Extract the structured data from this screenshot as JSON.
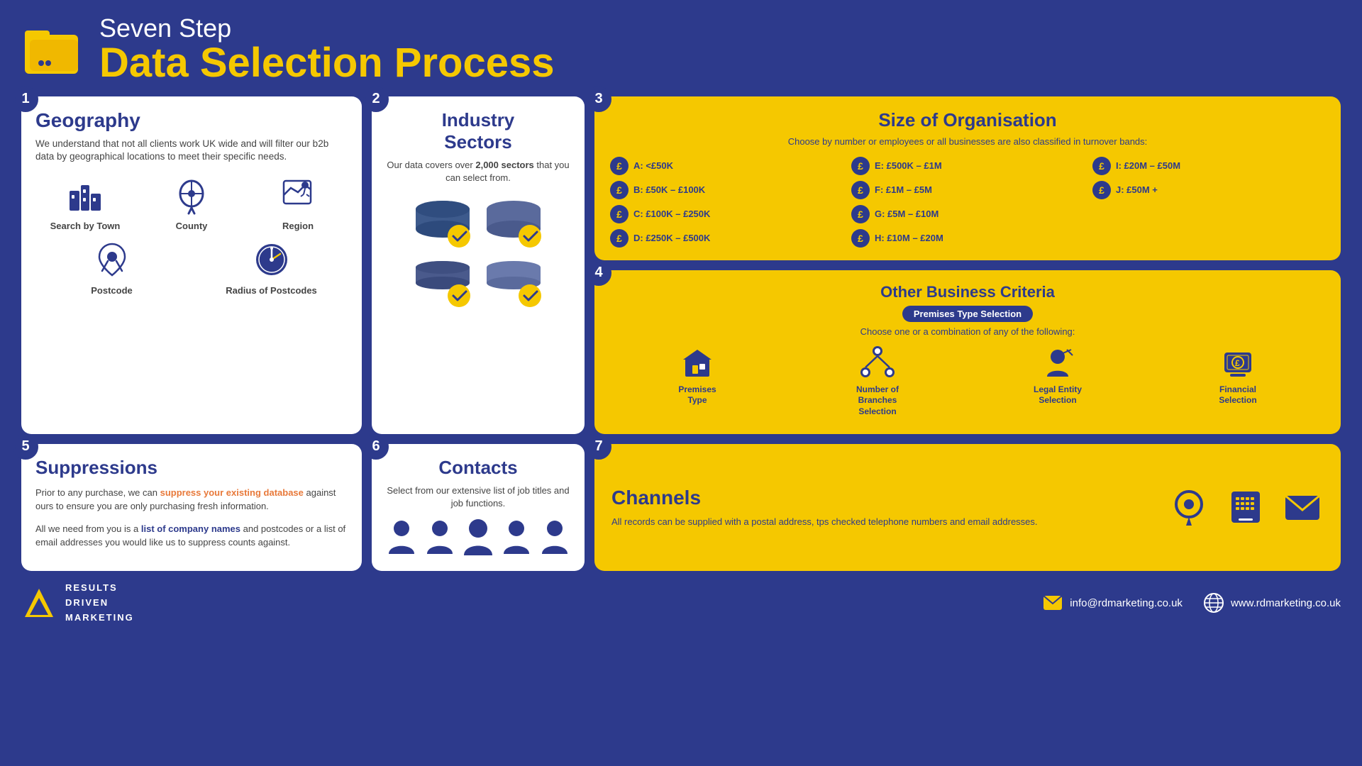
{
  "header": {
    "subtitle": "Seven Step",
    "title": "Data Selection Process"
  },
  "step1": {
    "badge": "1",
    "title": "Geography",
    "desc": "We understand that not all clients work UK wide and will filter our b2b data by geographical locations to meet their specific needs.",
    "items": [
      {
        "label": "Search by Town"
      },
      {
        "label": "County"
      },
      {
        "label": "Region"
      },
      {
        "label": "Postcode"
      },
      {
        "label": "Radius of Postcodes"
      }
    ]
  },
  "step2": {
    "badge": "2",
    "title": "Industry\nSectors",
    "desc_plain": "Our data covers over ",
    "desc_bold": "2,000 sectors",
    "desc_end": " that you can select from."
  },
  "step3": {
    "badge": "3",
    "title": "Size of Organisation",
    "desc": "Choose by number or employees or all businesses are also classified in turnover bands:",
    "items": [
      {
        "label": "A: <£50K"
      },
      {
        "label": "E: £500K – £1M"
      },
      {
        "label": "I: £20M – £50M"
      },
      {
        "label": "B: £50K – £100K"
      },
      {
        "label": "F: £1M – £5M"
      },
      {
        "label": "J: £50M +"
      },
      {
        "label": "C: £100K – £250K"
      },
      {
        "label": "G: £5M – £10M"
      },
      {
        "label": ""
      },
      {
        "label": "D: £250K – £500K"
      },
      {
        "label": "H: £10M – £20M"
      },
      {
        "label": ""
      }
    ]
  },
  "step4": {
    "badge": "4",
    "title": "Other Business Criteria",
    "badge_label": "Premises Type Selection",
    "desc": "Choose one or a combination of any of the following:",
    "items": [
      {
        "label": "Premises\nType"
      },
      {
        "label": "Number of\nBranches\nSelection"
      },
      {
        "label": "Legal Entity\nSelection"
      },
      {
        "label": "Financial\nSelection"
      }
    ]
  },
  "step5": {
    "badge": "5",
    "title": "Suppressions",
    "desc1": "Prior to any purchase, we can ",
    "desc1_highlight": "suppress your existing database",
    "desc1_end": " against ours to ensure you are only purchasing fresh information.",
    "desc2_start": "All we need from you is a ",
    "desc2_highlight": "list of company names",
    "desc2_end": " and postcodes or a list of email addresses you would like us to suppress counts against."
  },
  "step6": {
    "badge": "6",
    "title": "Contacts",
    "desc": "Select from our extensive list of job titles and job functions."
  },
  "step7": {
    "badge": "7",
    "title": "Channels",
    "desc": "All records can be supplied with a postal address, tps checked telephone numbers and email addresses."
  },
  "footer": {
    "logo_line1": "RESULTS",
    "logo_line2": "DRIVEN",
    "logo_line3": "MARKETING",
    "email": "info@rdmarketing.co.uk",
    "website": "www.rdmarketing.co.uk"
  }
}
